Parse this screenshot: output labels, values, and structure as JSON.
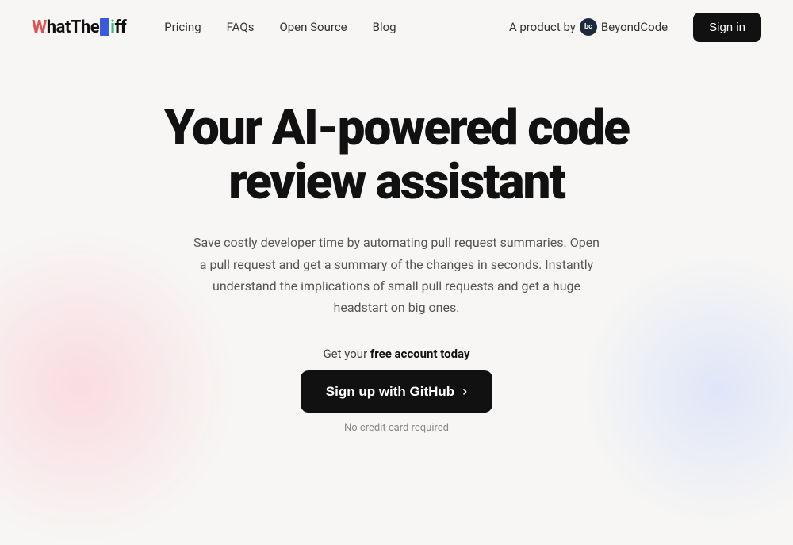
{
  "nav": {
    "logo": {
      "text": "What The Diff",
      "parts": {
        "w": "W",
        "hat": "hat ",
        "t": "T",
        "he": "he ",
        "d": "D",
        "iff": "iff"
      }
    },
    "links": [
      {
        "label": "Pricing",
        "name": "pricing-link"
      },
      {
        "label": "FAQs",
        "name": "faqs-link"
      },
      {
        "label": "Open Source",
        "name": "open-source-link"
      },
      {
        "label": "Blog",
        "name": "blog-link"
      }
    ],
    "product_prefix": "A product by",
    "product_brand": "BeyondCode",
    "product_brand_short": "bc",
    "signin_label": "Sign in"
  },
  "hero": {
    "title": "Your AI-powered code review assistant",
    "subtitle": "Save costly developer time by automating pull request summaries. Open a pull request and get a summary of the changes in seconds. Instantly understand the implications of small pull requests and get a huge headstart on big ones.",
    "cta_pre": "Get your ",
    "cta_bold": "free account today",
    "signup_button": "Sign up with GitHub",
    "signup_arrow": "›",
    "no_cc": "No credit card required"
  }
}
